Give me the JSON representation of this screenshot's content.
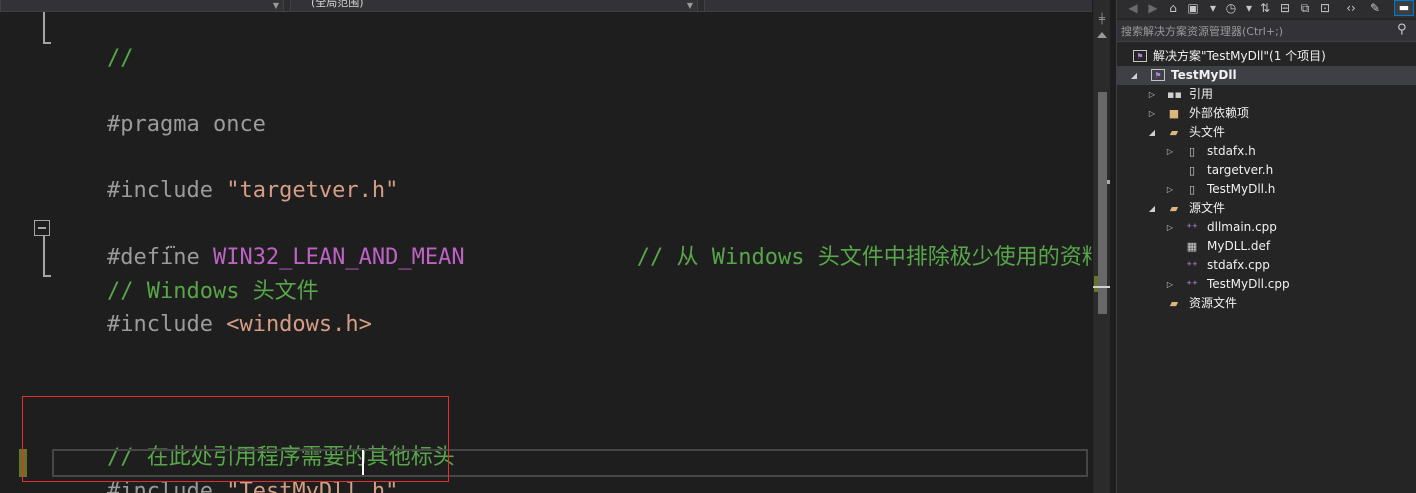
{
  "editor": {
    "nav_left": "",
    "nav_scope": "(全局范围)",
    "nav_right": "",
    "lines": {
      "comment_end": "//",
      "pragma_kw": "#pragma",
      "pragma_rest": " once",
      "inc1_kw": "#include ",
      "inc1_str": "\"targetver.h\"",
      "define_kw": "#define ",
      "define_macro": "WIN32_LEAN_AND_MEAN",
      "define_comment": "             // 从 Windows 头文件中排除极少使用的资料",
      "wrap_comment": "// Windows 头文件",
      "inc2_kw": "#include ",
      "inc2_angle": "<windows.h>",
      "todo_comment": "// 在此处引用程序需要的其他标头",
      "inc3_kw": "#include ",
      "inc3_str": "\"TestMyDll.h\""
    },
    "ellipsis": "…"
  },
  "solution_explorer": {
    "toolbar_icons": [
      "back-icon",
      "forward-icon",
      "home-icon",
      "switch-views-icon",
      "history-icon",
      "sync-icon",
      "collapse-all-icon",
      "copy-icon",
      "code-icon",
      "properties-icon",
      "preview-icon"
    ],
    "search_placeholder": "搜索解决方案资源管理器(Ctrl+;)",
    "tree": [
      {
        "label": "解决方案\"TestMyDll\"(1 个项目)",
        "icon": "solution-icon"
      },
      {
        "label": "TestMyDll",
        "icon": "project-icon"
      },
      {
        "label": "引用",
        "icon": "references-icon"
      },
      {
        "label": "外部依赖项",
        "icon": "external-deps-icon"
      },
      {
        "label": "头文件",
        "icon": "folder-icon"
      },
      {
        "label": "stdafx.h",
        "icon": "header-file-icon"
      },
      {
        "label": "targetver.h",
        "icon": "header-file-icon"
      },
      {
        "label": "TestMyDll.h",
        "icon": "header-file-icon"
      },
      {
        "label": "源文件",
        "icon": "folder-icon"
      },
      {
        "label": "dllmain.cpp",
        "icon": "cpp-file-icon"
      },
      {
        "label": "MyDLL.def",
        "icon": "def-file-icon"
      },
      {
        "label": "stdafx.cpp",
        "icon": "cpp-file-icon"
      },
      {
        "label": "TestMyDll.cpp",
        "icon": "cpp-file-icon"
      },
      {
        "label": "资源文件",
        "icon": "folder-icon"
      }
    ]
  }
}
